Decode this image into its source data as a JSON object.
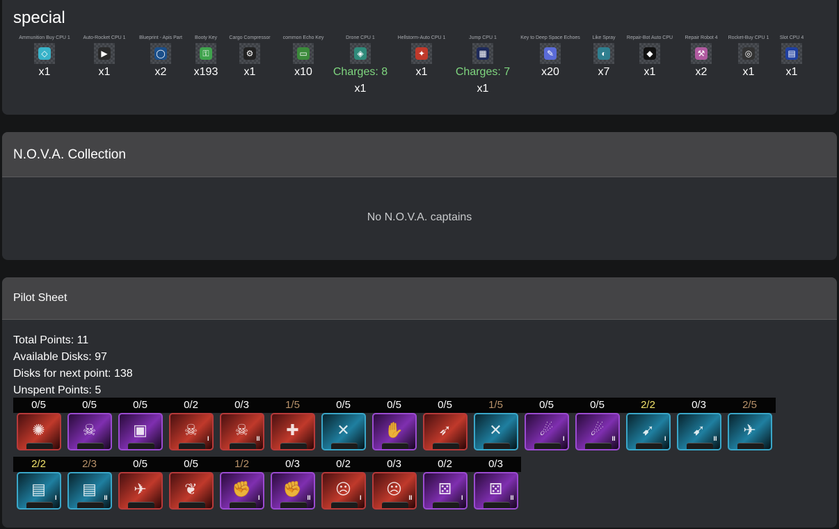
{
  "special": {
    "title": "special",
    "items": [
      {
        "label": "Ammunition Buy CPU 1",
        "quantity": "x1",
        "icon": "ammo-cpu-icon",
        "color": "#39b3c9",
        "glyph": "◇"
      },
      {
        "label": "Auto-Rocket CPU 1",
        "quantity": "x1",
        "icon": "auto-rocket-cpu-icon",
        "color": "#2a2a2a",
        "glyph": "▶"
      },
      {
        "label": "Blueprint - Apis Part",
        "quantity": "x2",
        "icon": "blueprint-icon",
        "color": "#1b4f8a",
        "glyph": "◯"
      },
      {
        "label": "Booty Key",
        "quantity": "x193",
        "icon": "booty-key-icon",
        "color": "#3fa34d",
        "glyph": "⚿"
      },
      {
        "label": "Cargo Compressor",
        "quantity": "x1",
        "icon": "cargo-compressor-icon",
        "color": "#222222",
        "glyph": "⚙"
      },
      {
        "label": "common Echo Key",
        "quantity": "x10",
        "icon": "echo-key-icon",
        "color": "#3b8a3b",
        "glyph": "▭"
      },
      {
        "label": "Drone CPU 1",
        "charges": "Charges: 8",
        "quantity": "x1",
        "icon": "drone-cpu-icon",
        "color": "#2f8a7a",
        "glyph": "◈"
      },
      {
        "label": "Hellstorm-Auto CPU 1",
        "quantity": "x1",
        "icon": "hellstorm-cpu-icon",
        "color": "#c0392b",
        "glyph": "✦"
      },
      {
        "label": "Jump CPU 1",
        "charges": "Charges: 7",
        "quantity": "x1",
        "icon": "jump-cpu-icon",
        "color": "#1e2a5a",
        "glyph": "▦"
      },
      {
        "label": "Key to Deep Space Echoes",
        "quantity": "x20",
        "icon": "deep-space-key-icon",
        "color": "#5a6bd8",
        "glyph": "✎"
      },
      {
        "label": "Like Spray",
        "quantity": "x7",
        "icon": "spray-icon",
        "color": "#2f7f8f",
        "glyph": "◐"
      },
      {
        "label": "Repair-Bot Auto CPU",
        "quantity": "x1",
        "icon": "repair-bot-cpu-icon",
        "color": "#111111",
        "glyph": "◆"
      },
      {
        "label": "Repair Robot 4",
        "quantity": "x2",
        "icon": "repair-robot-icon",
        "color": "#b05aa0",
        "glyph": "⚒"
      },
      {
        "label": "Rocket-Buy CPU 1",
        "quantity": "x1",
        "icon": "rocket-buy-cpu-icon",
        "color": "#333333",
        "glyph": "◎"
      },
      {
        "label": "Slot CPU 4",
        "quantity": "x1",
        "icon": "slot-cpu-icon",
        "color": "#2040a0",
        "glyph": "▤"
      }
    ]
  },
  "nova": {
    "title": "N.O.V.A. Collection",
    "empty_text": "No N.O.V.A. captains"
  },
  "pilot": {
    "title": "Pilot Sheet",
    "total_points": "Total Points: 11",
    "available_disks": "Available Disks: 97",
    "disks_next": "Disks for next point: 138",
    "unspent_points": "Unspent Points: 5",
    "skills_row1": [
      {
        "count": "0/5",
        "state": "empty",
        "theme": "red",
        "icon": "explosion-icon",
        "glyph": "✺",
        "tier": ""
      },
      {
        "count": "0/5",
        "state": "empty",
        "theme": "purple",
        "icon": "pirate-captain-icon",
        "glyph": "☠",
        "tier": ""
      },
      {
        "count": "0/5",
        "state": "empty",
        "theme": "purple",
        "icon": "cargo-box-icon",
        "glyph": "▣",
        "tier": ""
      },
      {
        "count": "0/2",
        "state": "empty",
        "theme": "red",
        "icon": "skull-icon",
        "glyph": "☠",
        "tier": "I"
      },
      {
        "count": "0/3",
        "state": "empty",
        "theme": "red",
        "icon": "skull-icon",
        "glyph": "☠",
        "tier": "II"
      },
      {
        "count": "1/5",
        "state": "partial",
        "theme": "red",
        "icon": "rifle-icon",
        "glyph": "✚",
        "tier": ""
      },
      {
        "count": "0/5",
        "state": "empty",
        "theme": "cyan",
        "icon": "wrench-icon",
        "glyph": "✕",
        "tier": ""
      },
      {
        "count": "0/5",
        "state": "empty",
        "theme": "purple",
        "icon": "hand-icon",
        "glyph": "✋",
        "tier": ""
      },
      {
        "count": "0/5",
        "state": "empty",
        "theme": "red",
        "icon": "rocket-icon",
        "glyph": "➶",
        "tier": ""
      },
      {
        "count": "1/5",
        "state": "partial",
        "theme": "cyan",
        "icon": "wrench-icon",
        "glyph": "✕",
        "tier": ""
      },
      {
        "count": "0/5",
        "state": "empty",
        "theme": "purple",
        "icon": "comet-icon",
        "glyph": "☄",
        "tier": "I"
      },
      {
        "count": "0/5",
        "state": "empty",
        "theme": "purple",
        "icon": "comet-icon",
        "glyph": "☄",
        "tier": "II"
      },
      {
        "count": "2/2",
        "state": "full",
        "theme": "cyan",
        "icon": "ship-icon",
        "glyph": "➹",
        "tier": "I"
      },
      {
        "count": "0/3",
        "state": "empty",
        "theme": "cyan",
        "icon": "ship-icon",
        "glyph": "➹",
        "tier": "II"
      },
      {
        "count": "2/5",
        "state": "partial",
        "theme": "cyan",
        "icon": "fighter-icon",
        "glyph": "✈",
        "tier": ""
      }
    ],
    "skills_row2": [
      {
        "count": "2/2",
        "state": "full",
        "theme": "cyan",
        "icon": "money-icon",
        "glyph": "▤",
        "tier": "I"
      },
      {
        "count": "2/3",
        "state": "partial",
        "theme": "cyan",
        "icon": "money-icon",
        "glyph": "▤",
        "tier": "II"
      },
      {
        "count": "0/5",
        "state": "empty",
        "theme": "red",
        "icon": "jet-icon",
        "glyph": "✈",
        "tier": ""
      },
      {
        "count": "0/5",
        "state": "empty",
        "theme": "red",
        "icon": "gift-icon",
        "glyph": "❦",
        "tier": ""
      },
      {
        "count": "1/2",
        "state": "partial",
        "theme": "purple",
        "icon": "fist-icon",
        "glyph": "✊",
        "tier": "I"
      },
      {
        "count": "0/3",
        "state": "empty",
        "theme": "purple",
        "icon": "fist-icon",
        "glyph": "✊",
        "tier": "II"
      },
      {
        "count": "0/2",
        "state": "empty",
        "theme": "red",
        "icon": "face-icon",
        "glyph": "☹",
        "tier": "I"
      },
      {
        "count": "0/3",
        "state": "empty",
        "theme": "red",
        "icon": "face-icon",
        "glyph": "☹",
        "tier": "II"
      },
      {
        "count": "0/2",
        "state": "empty",
        "theme": "purple",
        "icon": "dice-icon",
        "glyph": "⚄",
        "tier": "I"
      },
      {
        "count": "0/3",
        "state": "empty",
        "theme": "purple",
        "icon": "dice-icon",
        "glyph": "⚄",
        "tier": "II"
      }
    ]
  }
}
